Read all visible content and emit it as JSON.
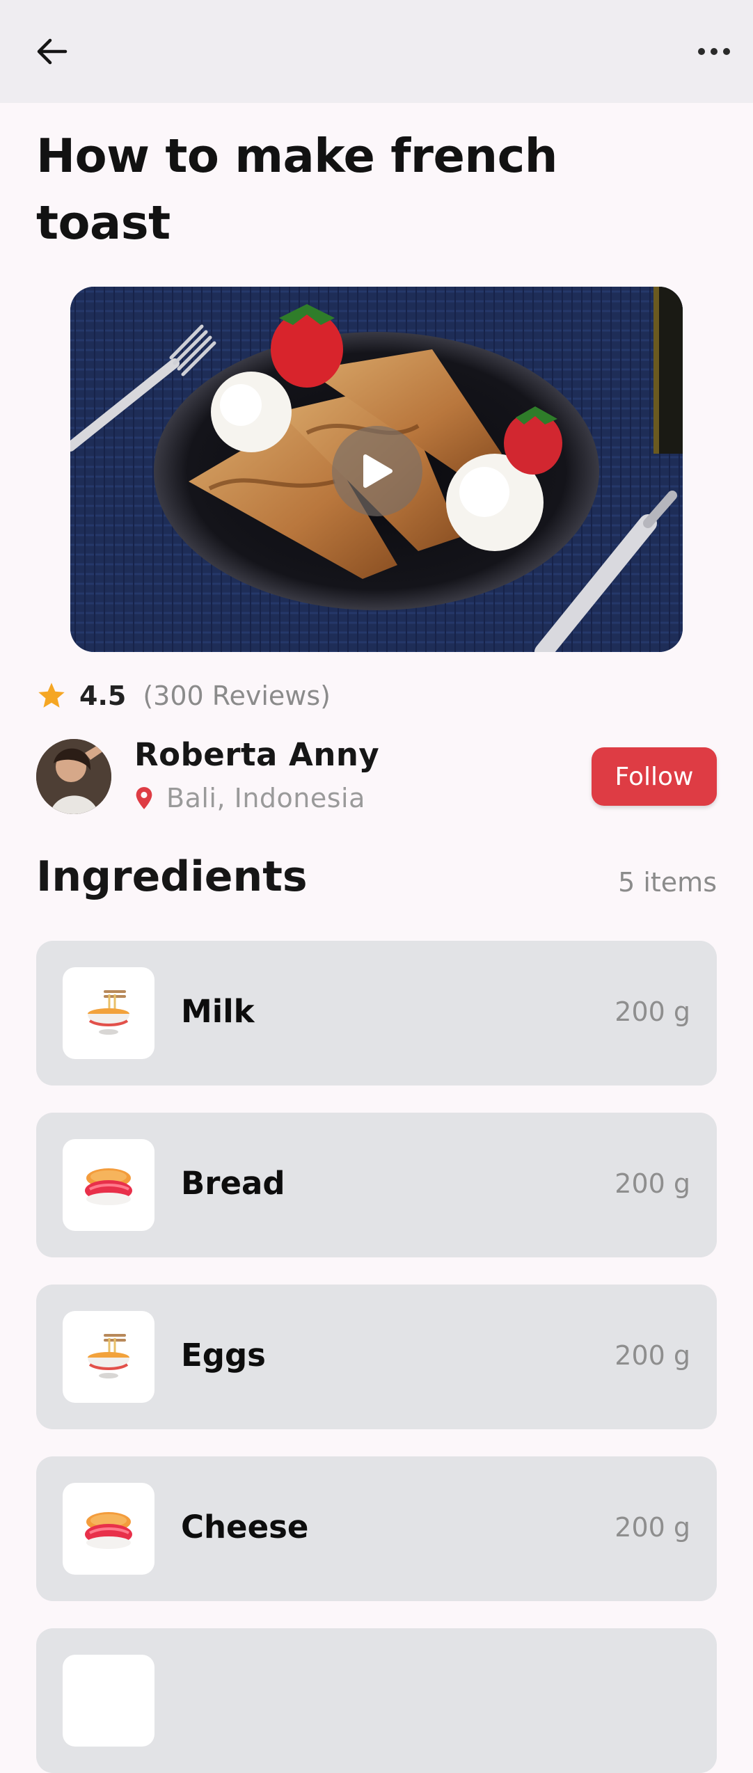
{
  "recipe": {
    "title": "How to make french toast"
  },
  "rating": {
    "value": "4.5",
    "reviews": "(300 Reviews)"
  },
  "author": {
    "name": "Roberta Anny",
    "location": "Bali, Indonesia",
    "follow_label": "Follow"
  },
  "ingredients": {
    "title": "Ingredients",
    "count": "5 items",
    "items": [
      {
        "name": "Milk",
        "qty": "200 g",
        "icon": "noodle-bowl-icon"
      },
      {
        "name": "Bread",
        "qty": "200 g",
        "icon": "sushi-icon"
      },
      {
        "name": "Eggs",
        "qty": "200 g",
        "icon": "noodle-bowl-icon"
      },
      {
        "name": "Cheese",
        "qty": "200 g",
        "icon": "sushi-icon"
      },
      {
        "name": "",
        "qty": "",
        "icon": "food-icon"
      }
    ]
  },
  "colors": {
    "accent": "#de3c44",
    "star": "#f5a623",
    "card": "#e2e3e6",
    "topbar": "#efedf1"
  }
}
